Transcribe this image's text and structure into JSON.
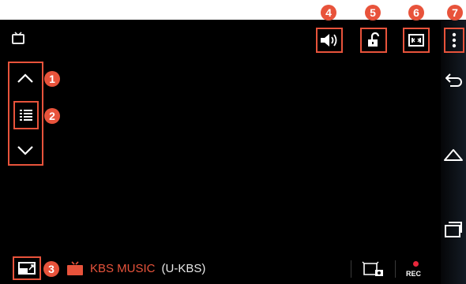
{
  "callouts": [
    "1",
    "2",
    "3",
    "4",
    "5",
    "6",
    "7"
  ],
  "channel": {
    "name": "KBS MUSIC",
    "code": "(U-KBS)"
  },
  "rec_label": "REC",
  "colors": {
    "accent": "#e8533b",
    "background": "#000000",
    "record": "#e8273b"
  },
  "icons": {
    "status": "tv-icon",
    "toolbar": [
      "volume-icon",
      "lock-icon",
      "aspect-ratio-icon",
      "overflow-menu-icon"
    ],
    "side": [
      "channel-up-icon",
      "channel-list-icon",
      "channel-down-icon"
    ],
    "bottom": [
      "pip-icon",
      "tv-channel-icon",
      "capture-icon",
      "record-icon"
    ],
    "navbar": [
      "back-icon",
      "home-icon",
      "recent-apps-icon"
    ]
  }
}
